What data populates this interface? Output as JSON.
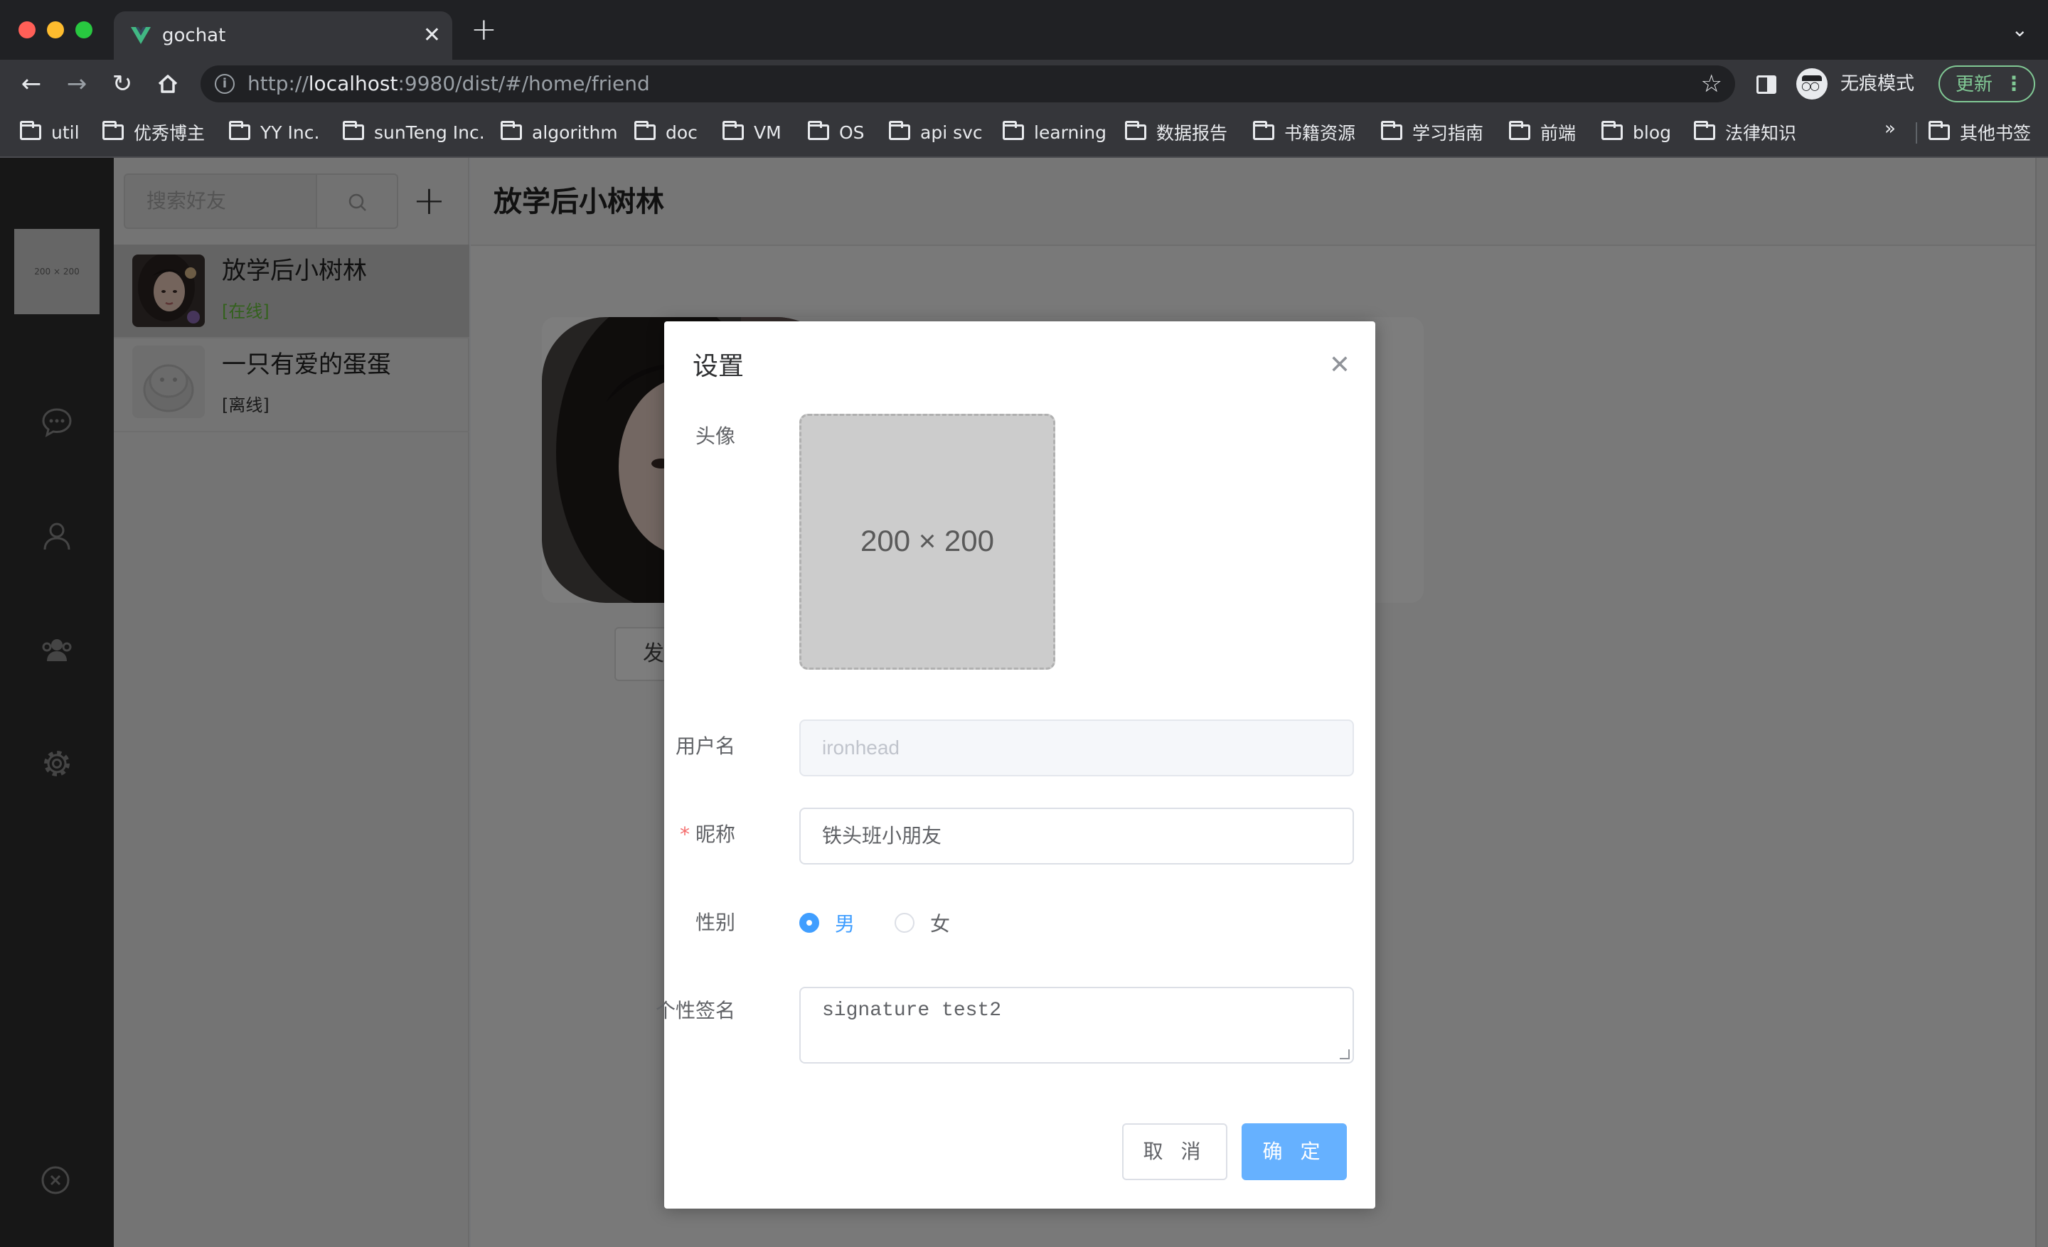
{
  "browser": {
    "tab_title": "gochat",
    "url_prefix": "http://",
    "url_host": "localhost",
    "url_rest": ":9980/dist/#/home/friend",
    "incognito_label": "无痕模式",
    "update_label": "更新",
    "bookmarks": [
      "util",
      "优秀博主",
      "YY Inc.",
      "sunTeng Inc.",
      "algorithm",
      "doc",
      "VM",
      "OS",
      "api svc",
      "learning",
      "数据报告",
      "书籍资源",
      "学习指南",
      "前端",
      "blog",
      "法律知识"
    ],
    "bookmarks_overflow": "»",
    "other_bookmarks": "其他书签"
  },
  "rail": {
    "avatar_placeholder": "200 × 200",
    "icons": [
      "chat-icon",
      "user-icon",
      "group-icon",
      "settings-icon",
      "logout-icon"
    ]
  },
  "friends": {
    "search_placeholder": "搜索好友",
    "items": [
      {
        "name": "放学后小树林",
        "status": "[在线]",
        "status_color": "#67c23a"
      },
      {
        "name": "一只有爱的蛋蛋",
        "status": "[离线]",
        "status_color": "#333333"
      }
    ]
  },
  "chat": {
    "title": "放学后小树林",
    "send_button_partial": "发"
  },
  "dialog": {
    "title": "设置",
    "avatar_label": "头像",
    "avatar_placeholder": "200 × 200",
    "username_label": "用户名",
    "username_value": "ironhead",
    "nickname_label": "昵称",
    "nickname_value": "铁头班小朋友",
    "gender_label": "性别",
    "gender_options": [
      "男",
      "女"
    ],
    "gender_selected": "男",
    "signature_label": "个性签名",
    "signature_value": "signature test2",
    "cancel_label": "取 消",
    "ok_label": "确 定"
  },
  "colors": {
    "primary": "#409eff",
    "online": "#67c23a",
    "required": "#f56c6c"
  }
}
